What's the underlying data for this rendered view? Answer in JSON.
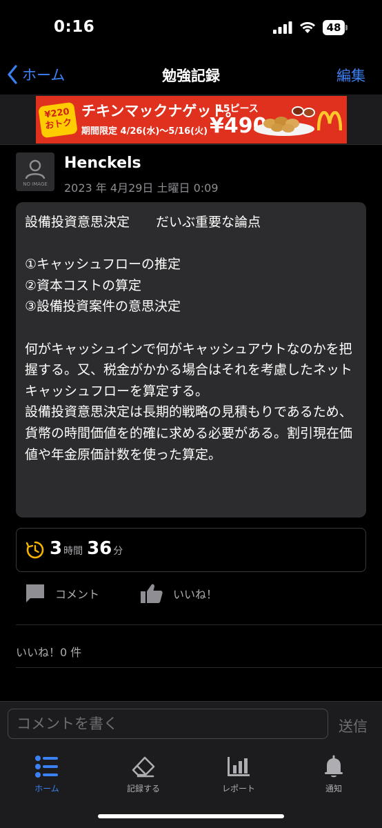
{
  "status_bar": {
    "time": "0:16",
    "battery": "48",
    "icons": [
      "signal-icon",
      "wifi-icon",
      "battery-icon"
    ]
  },
  "nav": {
    "back_label": "ホーム",
    "title": "勉強記録",
    "edit_label": "編集",
    "accent_color": "#3b82f6"
  },
  "ad": {
    "badge": "¥220 おトク",
    "headline": "チキンマックナゲット。",
    "period": "期間限定 4/26(水)～5/16(火)",
    "pieces": "15ピース",
    "price": "¥490",
    "brand_color": "#e0301e"
  },
  "post": {
    "avatar_caption": "NO IMAGE",
    "user_name": "Henckels",
    "date": "2023 年 4月29日 土曜日 0:09",
    "memo": "設備投資意思決定　　だいぶ重要な論点\n\n①キャッシュフローの推定\n②資本コストの算定\n③設備投資案件の意思決定\n\n何がキャッシュインで何がキャッシュアウトなのかを把握する。又、税金がかかる場合はそれを考慮したネットキャッシュフローを算定する。\n設備投資意思決定は長期的戦略の見積もりであるため、貨幣の時間価値を的確に求める必要がある。割引現在価値や年金原価計数を使った算定。",
    "duration": {
      "hours": "3",
      "hours_unit": "時間",
      "minutes": "36",
      "minutes_unit": "分"
    }
  },
  "actions": {
    "comment_label": "コメント",
    "like_label": "いいね！"
  },
  "likes_text": "いいね！0 件",
  "comment_box": {
    "placeholder": "コメントを書く",
    "value": "",
    "send_label": "送信"
  },
  "tabs": [
    {
      "label": "ホーム",
      "icon": "list-icon",
      "active": true
    },
    {
      "label": "記録する",
      "icon": "eraser-icon",
      "active": false
    },
    {
      "label": "レポート",
      "icon": "bar-chart-icon",
      "active": false
    },
    {
      "label": "通知",
      "icon": "bell-icon",
      "active": false
    }
  ]
}
